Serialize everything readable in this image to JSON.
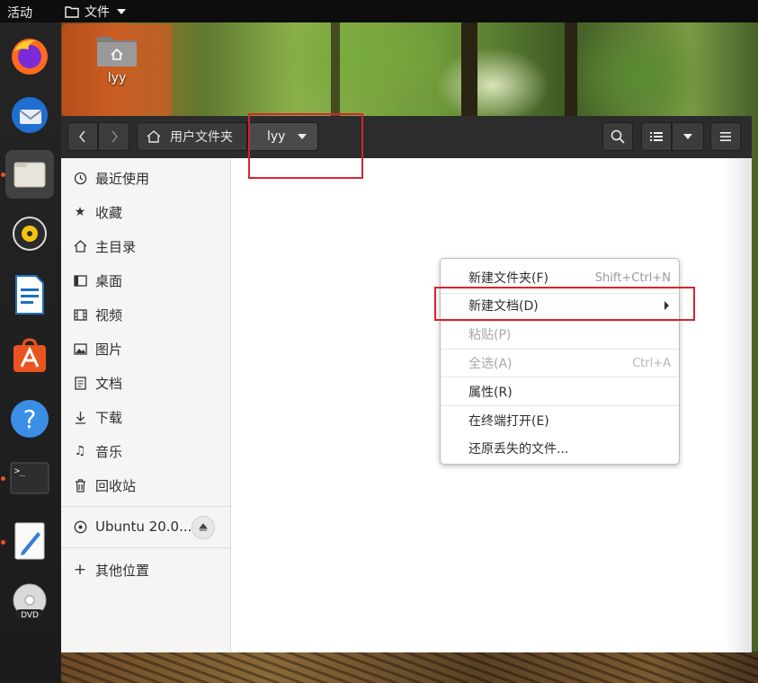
{
  "topbar": {
    "activities": "活动",
    "app_menu": "文件"
  },
  "desktop": {
    "folder_label": "lyy"
  },
  "dock": {
    "items": [
      "firefox-icon",
      "thunderbird-icon",
      "files-icon",
      "rhythmbox-icon",
      "libreoffice-writer-icon",
      "software-center-icon",
      "help-icon",
      "terminal-icon",
      "text-editor-icon",
      "dvd-icon"
    ],
    "accent": "#e95420"
  },
  "headerbar": {
    "back_icon": "chevron-left-icon",
    "forward_icon": "chevron-right-icon",
    "path_home": "用户文件夹",
    "path_current": "lyy"
  },
  "sidebar": {
    "recent": "最近使用",
    "starred": "收藏",
    "home": "主目录",
    "desktop": "桌面",
    "videos": "视频",
    "pictures": "图片",
    "documents": "文档",
    "downloads": "下载",
    "music": "音乐",
    "trash": "回收站",
    "volume": "Ubuntu 20.0...",
    "other": "其他位置"
  },
  "context_menu": {
    "new_folder": {
      "label": "新建文件夹(F)",
      "shortcut": "Shift+Ctrl+N"
    },
    "new_document": {
      "label": "新建文档(D)"
    },
    "paste": {
      "label": "粘贴(P)"
    },
    "select_all": {
      "label": "全选(A)",
      "shortcut": "Ctrl+A"
    },
    "properties": {
      "label": "属性(R)"
    },
    "open_terminal": {
      "label": "在终端打开(E)"
    },
    "restore": {
      "label": "还原丢失的文件..."
    }
  },
  "highlight_color": "#d9232d"
}
